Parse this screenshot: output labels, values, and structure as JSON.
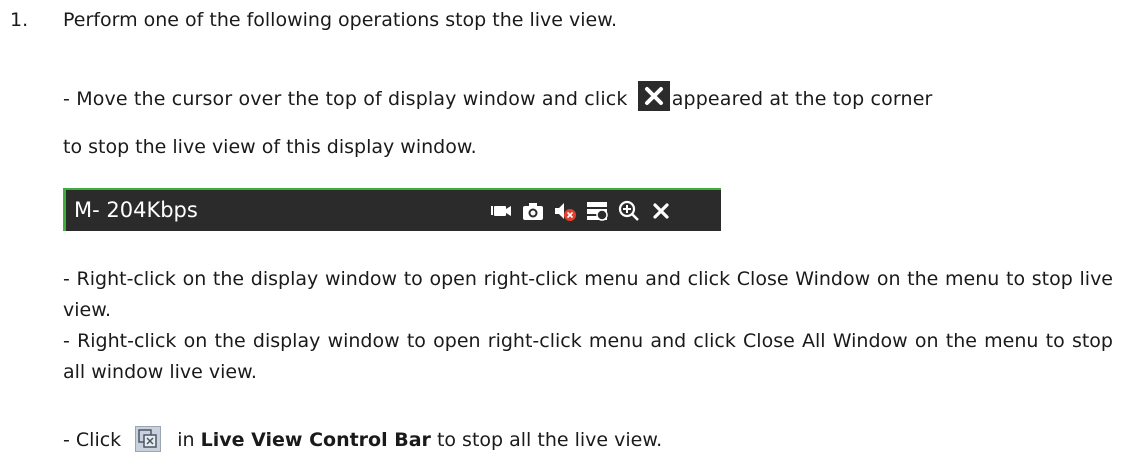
{
  "step": {
    "number": "1.",
    "text": "Perform one of the following operations stop the live view."
  },
  "bullet_close_icon": {
    "before": "- Move the cursor over the top of display window and click",
    "after": "appeared at the top corner",
    "continuation": "to stop the live view of this display window."
  },
  "toolbar": {
    "bitrate": "M- 204Kbps",
    "icons": [
      "record-icon",
      "camera-icon",
      "audio-muted-icon",
      "stream-icon",
      "zoom-icon",
      "close-icon"
    ],
    "accent": "#3fae3a",
    "background": "#2b2b2b"
  },
  "bullet_close_window": "- Right-click on the display window to open right-click menu and click Close Window on the menu to stop live view.",
  "bullet_close_all": "- Right-click on the display window to open right-click menu and click Close All Window on the menu to stop all window live view.",
  "bullet_click": {
    "before": "- Click",
    "middle": " in ",
    "bold": "Live View Control Bar",
    "after": " to stop all the live view."
  }
}
